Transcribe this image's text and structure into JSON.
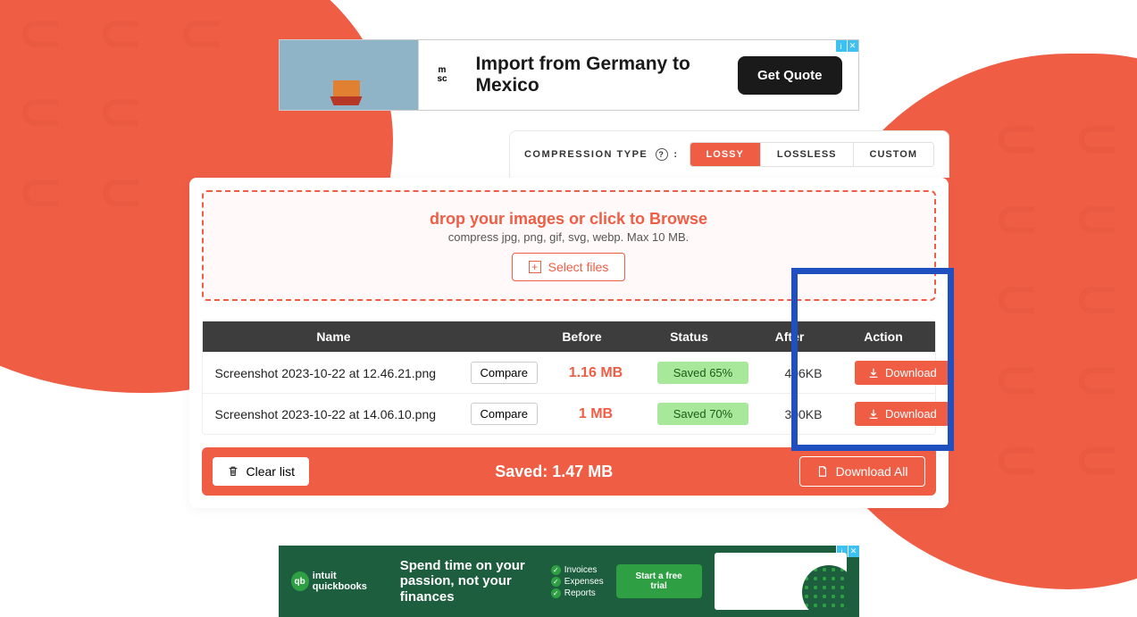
{
  "ad_top": {
    "logo": "msc",
    "headline": "Import from Germany to Mexico",
    "cta": "Get Quote"
  },
  "compression": {
    "label": "COMPRESSION TYPE",
    "tabs": [
      "LOSSY",
      "LOSSLESS",
      "CUSTOM"
    ],
    "active": "LOSSY"
  },
  "dropzone": {
    "title": "drop your images or click to Browse",
    "subtitle": "compress jpg, png, gif, svg, webp. Max 10 MB.",
    "select": "Select files"
  },
  "table": {
    "headers": [
      "Name",
      "Before",
      "Status",
      "After",
      "Action"
    ],
    "compare": "Compare",
    "download": "Download",
    "rows": [
      {
        "name": "Screenshot 2023-10-22 at 12.46.21.png",
        "before": "1.16 MB",
        "status": "Saved 65%",
        "after": "406KB"
      },
      {
        "name": "Screenshot 2023-10-22 at 14.06.10.png",
        "before": "1 MB",
        "status": "Saved 70%",
        "after": "300KB"
      }
    ]
  },
  "footer": {
    "clear": "Clear list",
    "saved": "Saved: 1.47 MB",
    "download_all": "Download All"
  },
  "ad_bottom": {
    "brand": "intuit quickbooks",
    "headline": "Spend time on your passion, not your finances",
    "features": [
      "Invoices",
      "Expenses",
      "Reports"
    ],
    "cta": "Start a free trial"
  }
}
